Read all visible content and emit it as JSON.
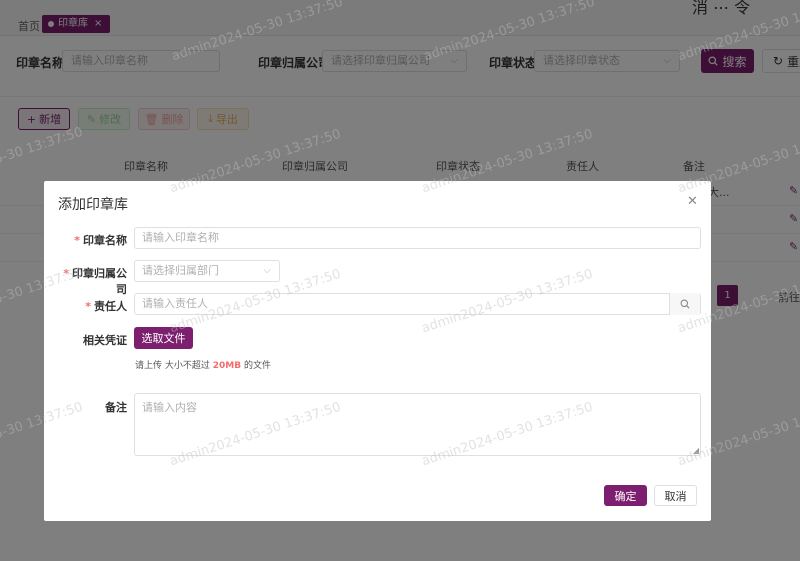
{
  "tabs": {
    "home_label": "首页",
    "active_label": "印章库"
  },
  "top_right_text": "消 ⋯ 令",
  "search": {
    "name_label": "印章名称",
    "name_placeholder": "请输入印章名称",
    "company_label": "印章归属公司",
    "company_placeholder": "请选择印章归属公司",
    "status_label": "印章状态",
    "status_placeholder": "请选择印章状态",
    "search_button": "搜索",
    "reset_button": "重置"
  },
  "toolbar": {
    "add": "新增",
    "edit": "修改",
    "delete": "删除",
    "export": "导出"
  },
  "table": {
    "headers": [
      "印章名称",
      "印章归属公司",
      "印章状态",
      "责任人",
      "备注"
    ],
    "rows": [
      {
        "remark": "大..."
      },
      {
        "remark": ""
      },
      {
        "remark": ""
      }
    ]
  },
  "pagination": {
    "current_page": "1",
    "goto_label": "前往"
  },
  "modal": {
    "title": "添加印章库",
    "name_label": "印章名称",
    "name_placeholder": "请输入印章名称",
    "company_label": "印章归属公司",
    "company_placeholder": "请选择归属部门",
    "owner_label": "责任人",
    "owner_placeholder": "请输入责任人",
    "file_label": "相关凭证",
    "file_button": "选取文件",
    "hint_prefix": "请上传 大小不超过",
    "hint_size": "20MB",
    "hint_suffix": "的文件",
    "remark_label": "备注",
    "remark_placeholder": "请输入内容",
    "ok_button": "确定",
    "cancel_button": "取消"
  },
  "watermark_text": "admin2024-05-30 13:37:50",
  "colors": {
    "primary": "#7b1f6e",
    "required": "#f56c6c"
  }
}
